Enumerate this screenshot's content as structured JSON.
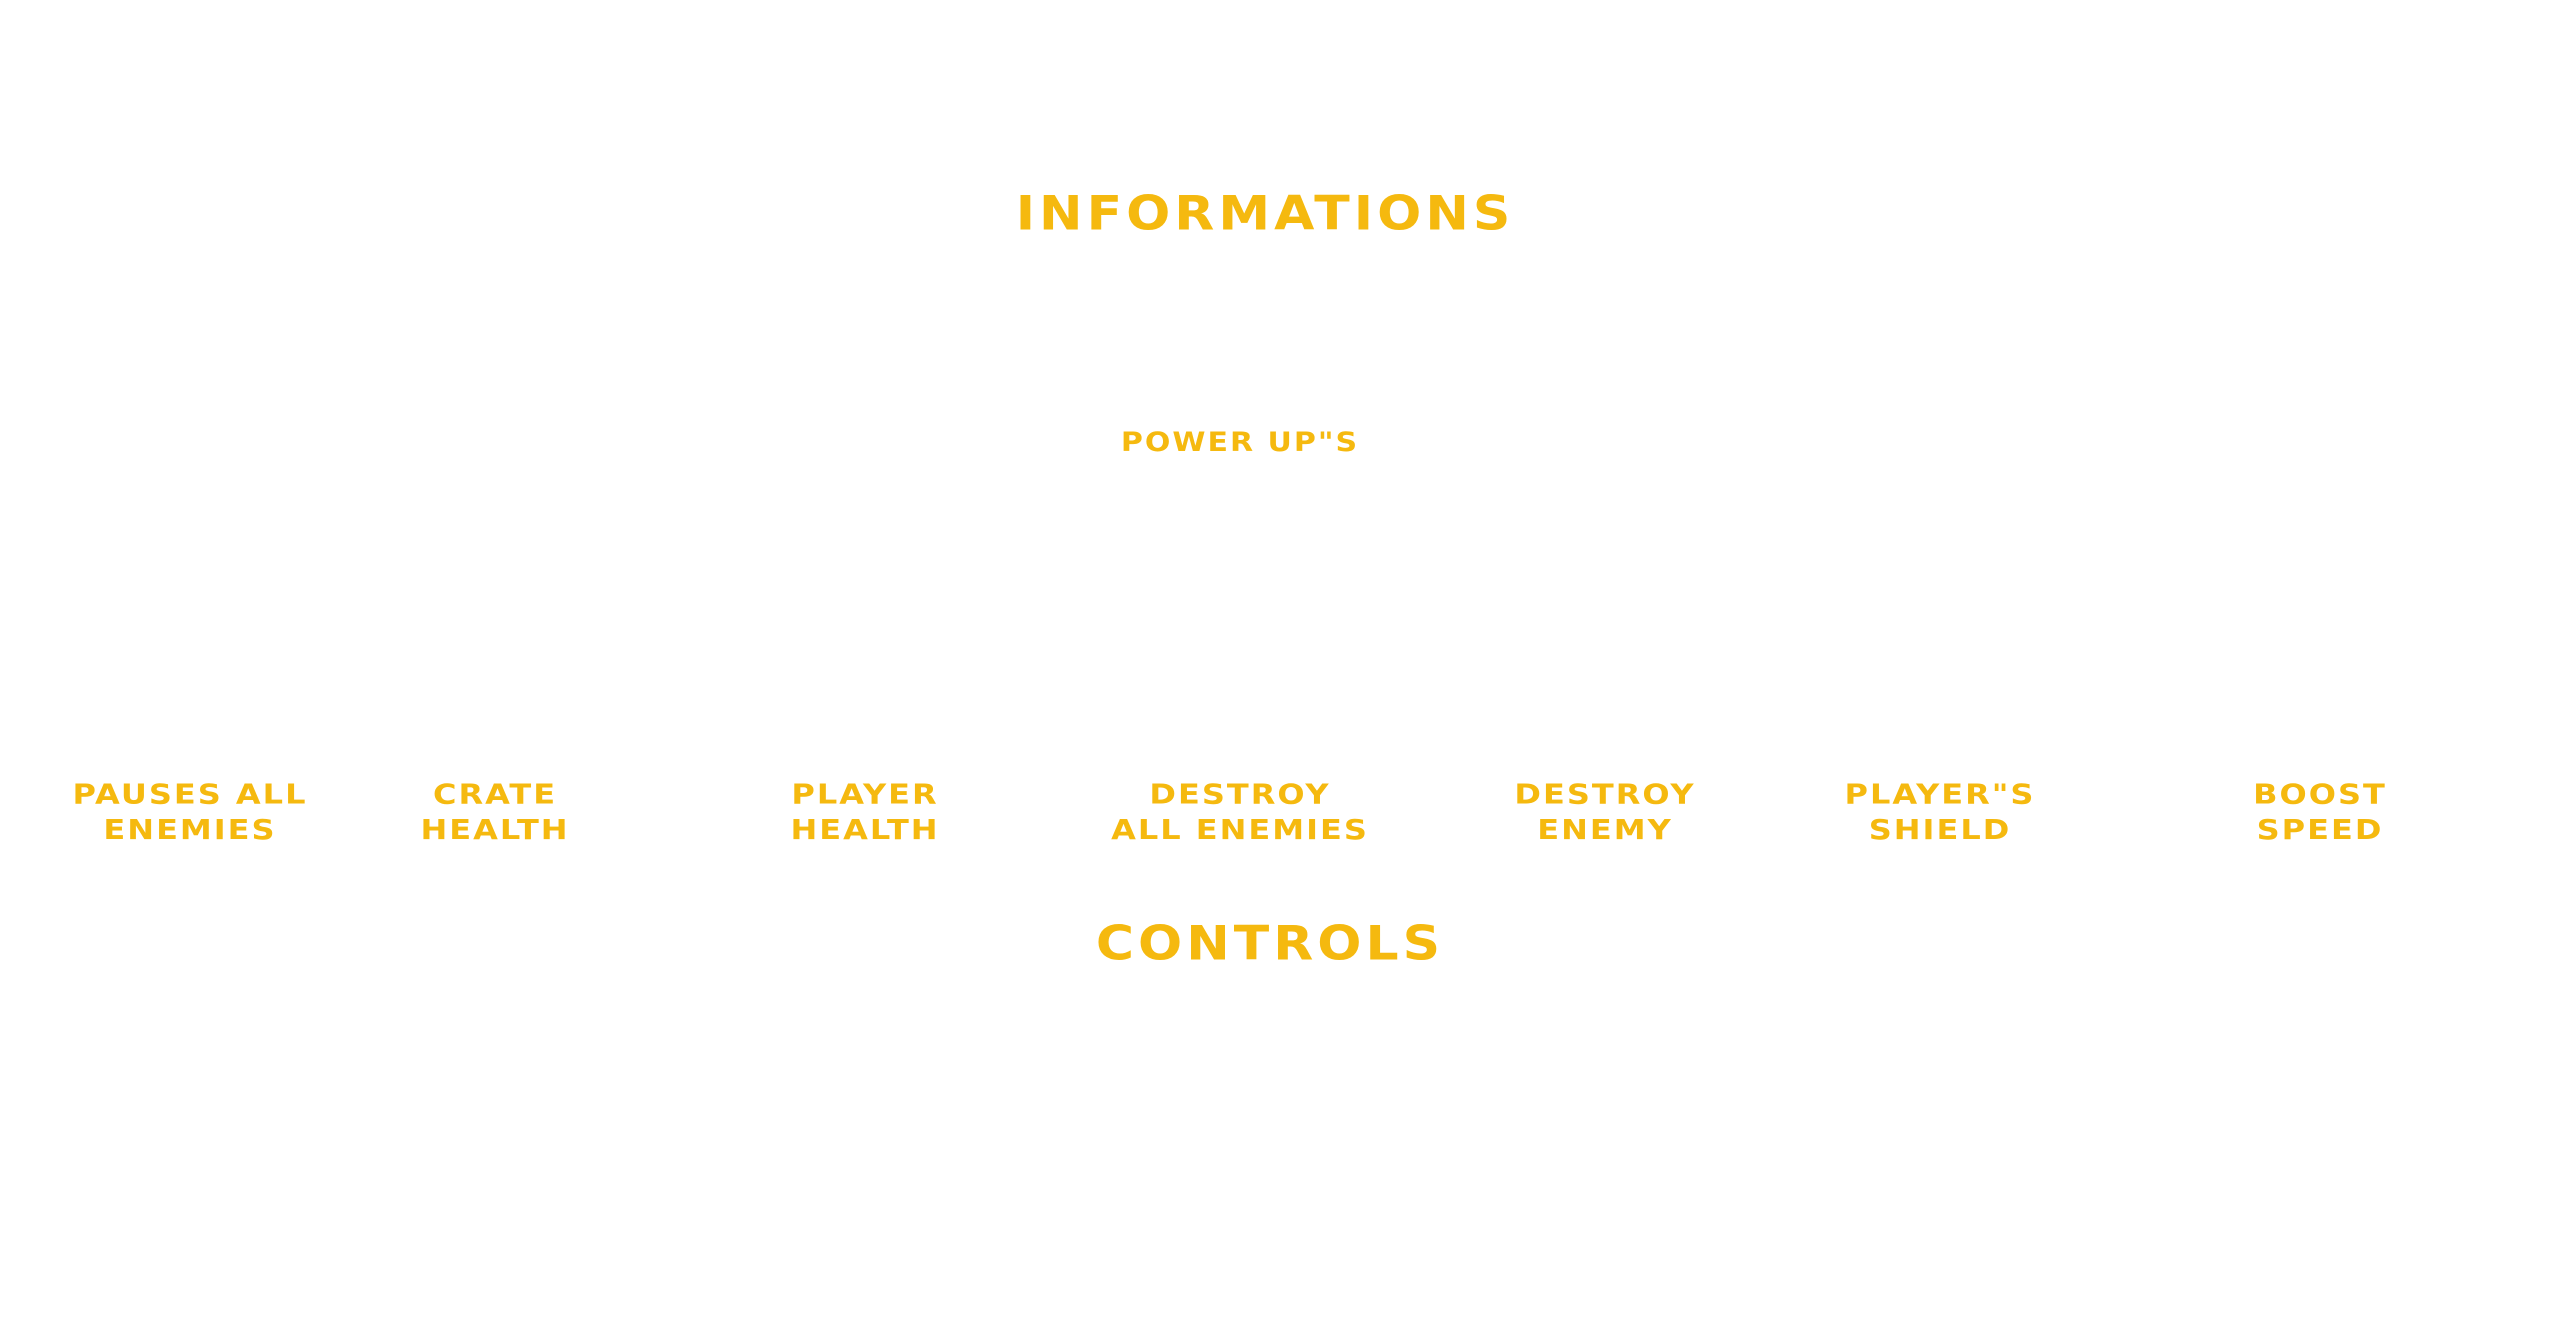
{
  "colors": {
    "background": "#ffffff",
    "text": "#f5b90f"
  },
  "titles": {
    "informations": "INFORMATIONS",
    "power_ups": "POWER UP\"S",
    "controls": "CONTROLS"
  },
  "power_ups": [
    {
      "line1": "PAUSES ALL",
      "line2": "ENEMIES"
    },
    {
      "line1": "CRATE",
      "line2": "HEALTH"
    },
    {
      "line1": "PLAYER",
      "line2": "HEALTH"
    },
    {
      "line1": "DESTROY",
      "line2": "ALL ENEMIES"
    },
    {
      "line1": "DESTROY",
      "line2": "ENEMY"
    },
    {
      "line1": "PLAYER\"S",
      "line2": "SHIELD"
    },
    {
      "line1": "BOOST",
      "line2": "SPEED"
    }
  ]
}
